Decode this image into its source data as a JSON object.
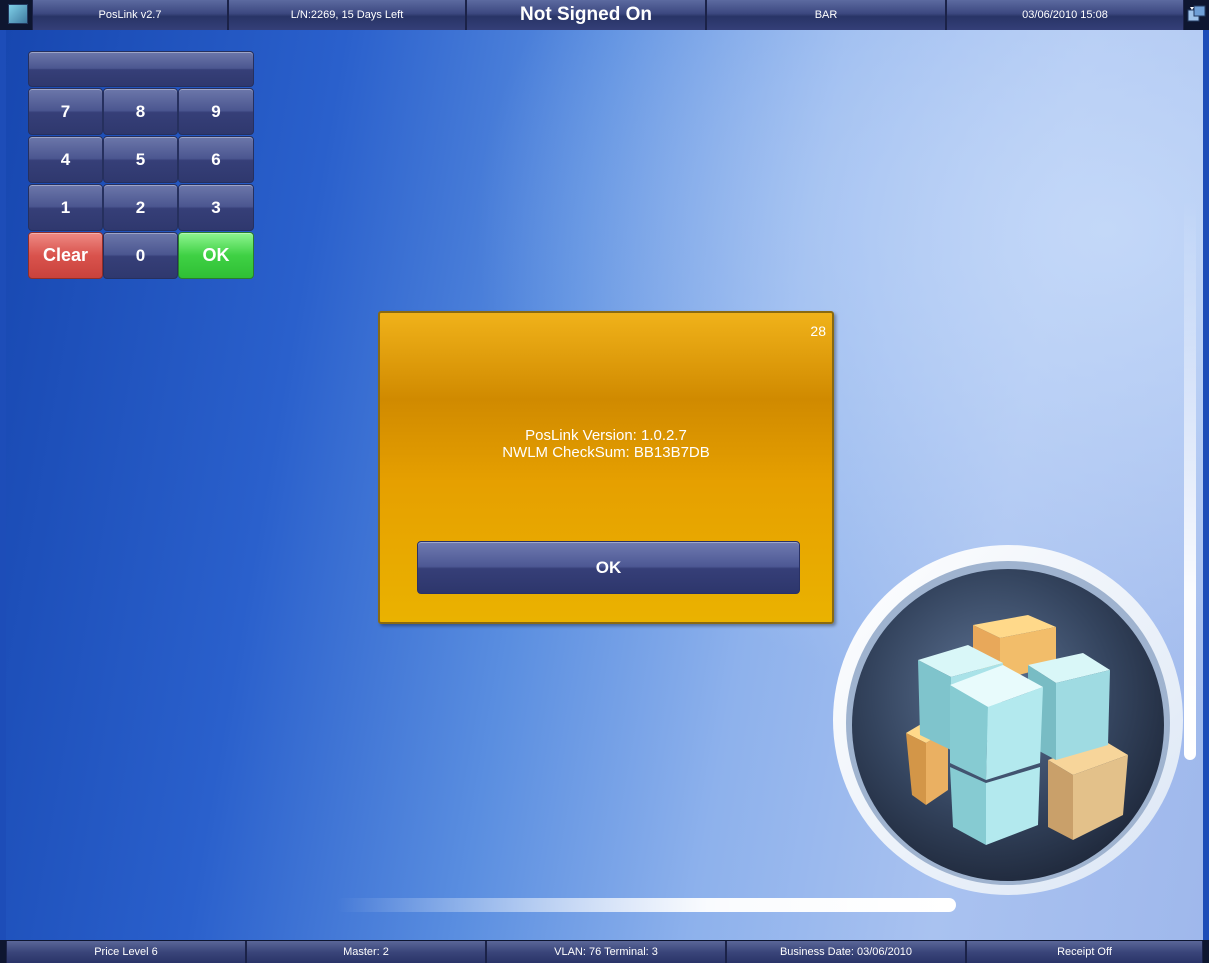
{
  "topbar": {
    "app_name": "PosLink v2.7",
    "license": "L/N:2269, 15 Days Left",
    "status": "Not Signed On",
    "location": "BAR",
    "datetime": "03/06/2010 15:08"
  },
  "keypad": {
    "display": "",
    "keys": [
      "7",
      "8",
      "9",
      "4",
      "5",
      "6",
      "1",
      "2",
      "3"
    ],
    "clear": "Clear",
    "zero": "0",
    "ok": "OK"
  },
  "dialog": {
    "counter": "28",
    "line1": "PosLink Version: 1.0.2.7",
    "line2": "NWLM CheckSum: BB13B7DB",
    "ok": "OK"
  },
  "bottombar": {
    "price_level": "Price Level 6",
    "master": "Master: 2",
    "vlan": "VLAN: 76 Terminal: 3",
    "business_date": "Business Date: 03/06/2010",
    "receipt": "Receipt Off"
  },
  "icons": {
    "app_icon": "app-icon",
    "swap_icon": "switch-window-icon",
    "logo": "cubes-logo"
  },
  "colors": {
    "dialog": "#e6a000",
    "clear_key": "#d9534d",
    "ok_key": "#3fd144",
    "bar": "#3c4880"
  }
}
